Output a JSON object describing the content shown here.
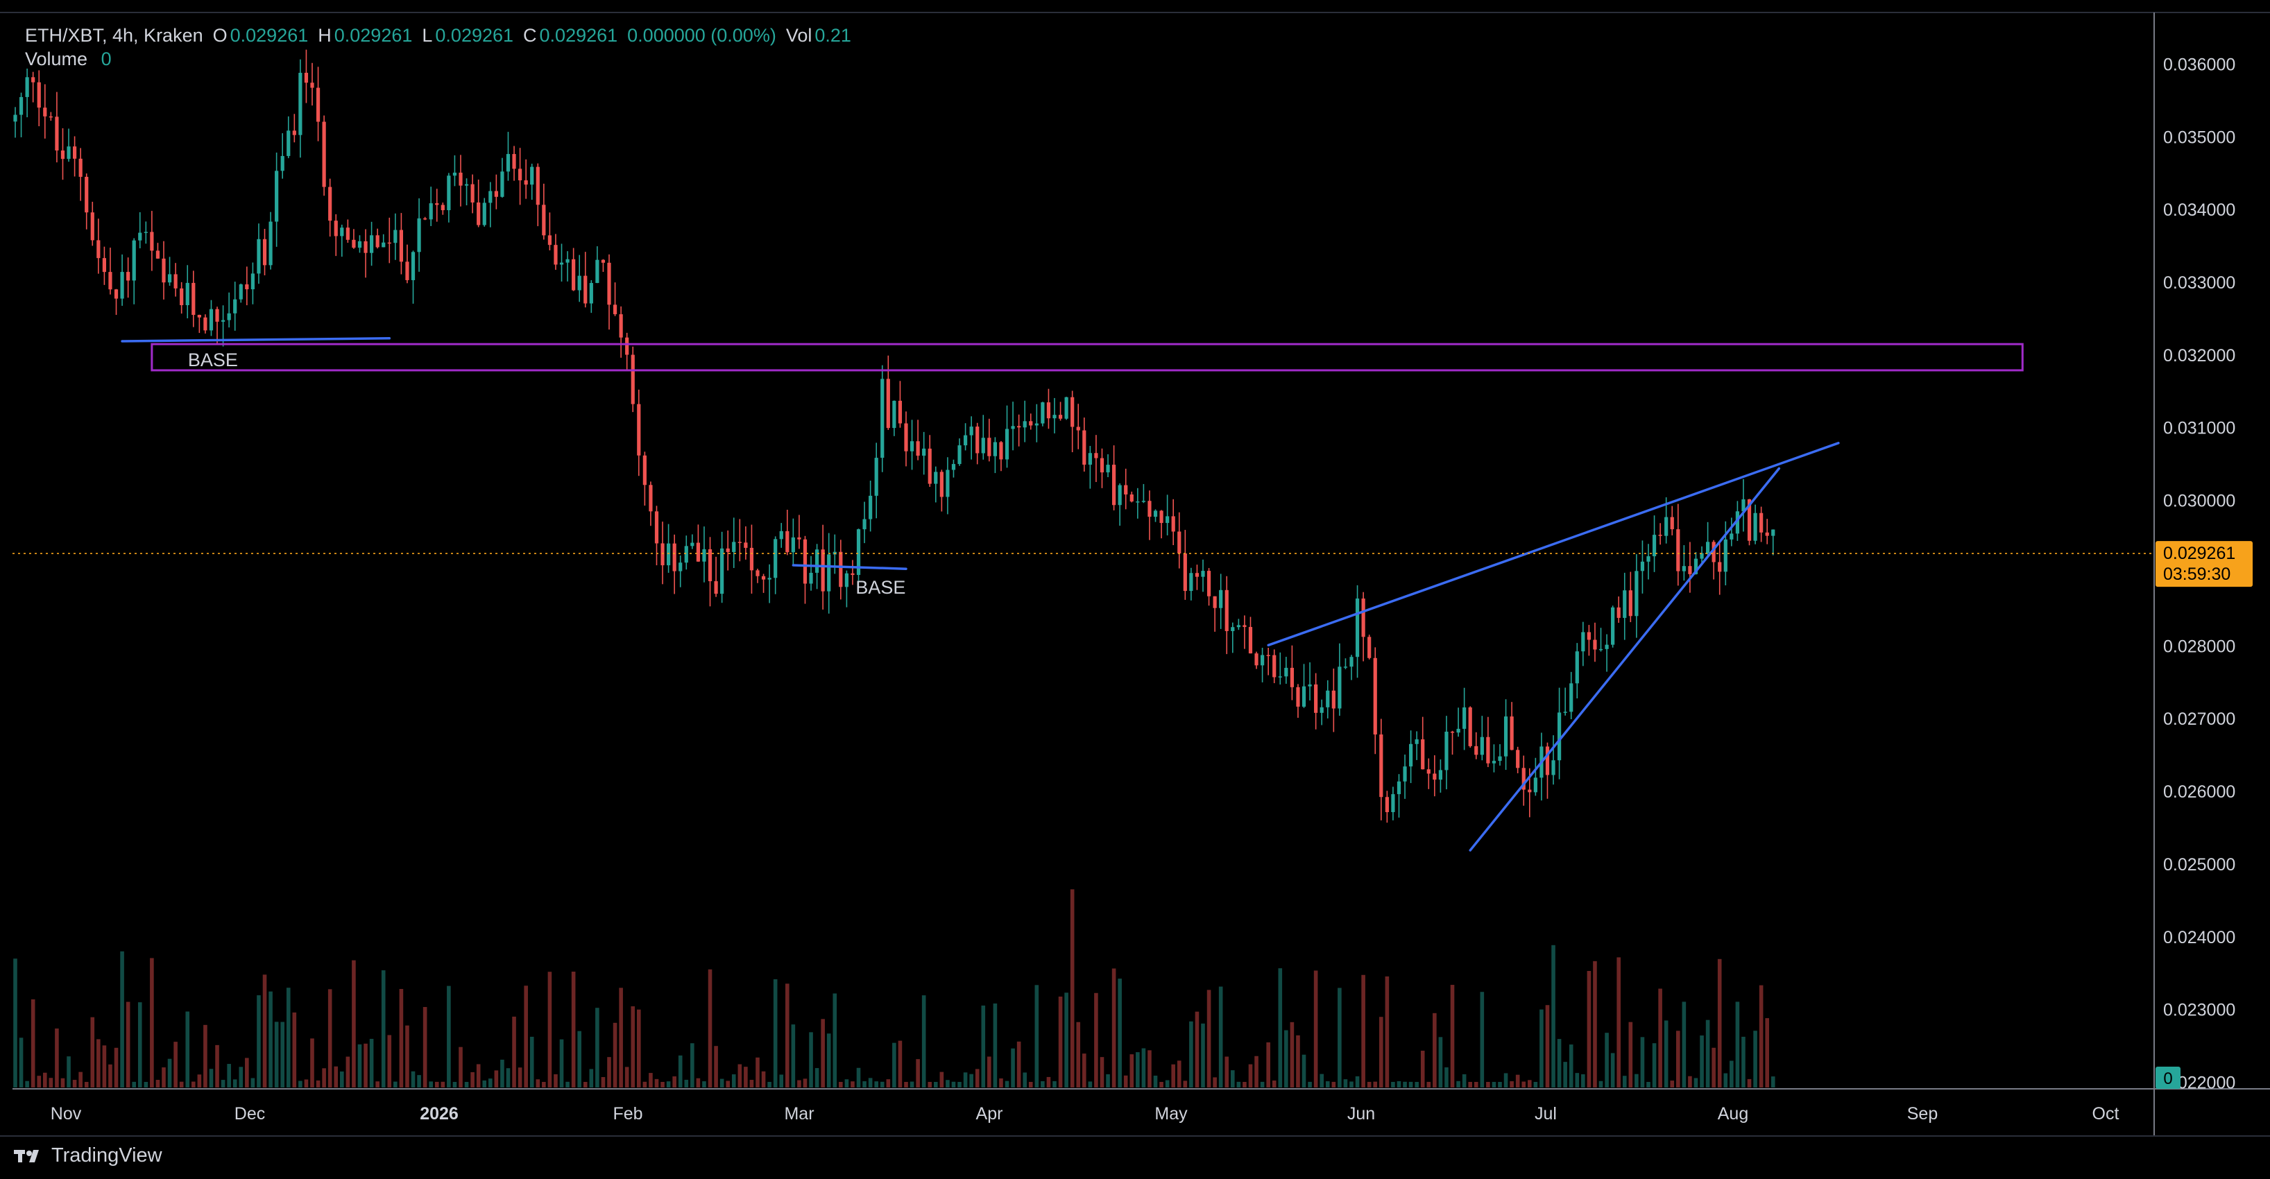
{
  "legend": {
    "symbol": "ETH/XBT, 4h, Kraken",
    "open_label": "O",
    "open": "0.029261",
    "high_label": "H",
    "high": "0.029261",
    "low_label": "L",
    "low": "0.029261",
    "close_label": "C",
    "close": "0.029261",
    "change": "0.000000 (0.00%)",
    "vol_label": "Vol",
    "vol": "0.21",
    "volume_label": "Volume",
    "volume_value": "0"
  },
  "price_tag": {
    "price": "0.029261",
    "countdown": "03:59:30"
  },
  "volume_tag": "0",
  "brand": "TradingView",
  "colors": {
    "up": "#26a69a",
    "down": "#ef5350",
    "line": "#3b6cf2",
    "zone": "#a02bc9",
    "price": "#f7a21b"
  },
  "chart_data": {
    "type": "candlestick",
    "y_ticks": [
      "0.036000",
      "0.035000",
      "0.034000",
      "0.033000",
      "0.032000",
      "0.031000",
      "0.030000",
      "0.029000",
      "0.028000",
      "0.027000",
      "0.026000",
      "0.025000",
      "0.024000",
      "0.023000",
      "0.022000"
    ],
    "x_ticks": [
      "Nov",
      "Dec",
      "2026",
      "Feb",
      "Mar",
      "Apr",
      "May",
      "Jun",
      "Jul",
      "Aug",
      "Sep",
      "Oct"
    ],
    "ylim": [
      0.0219,
      0.0367
    ],
    "price_path": [
      [
        0,
        0.0352
      ],
      [
        3,
        0.0359
      ],
      [
        7,
        0.0348
      ],
      [
        11,
        0.0345
      ],
      [
        14,
        0.0333
      ],
      [
        17,
        0.0327
      ],
      [
        21,
        0.0337
      ],
      [
        25,
        0.0329
      ],
      [
        29,
        0.0327
      ],
      [
        33,
        0.0325
      ],
      [
        38,
        0.0328
      ],
      [
        42,
        0.0335
      ],
      [
        46,
        0.035
      ],
      [
        49,
        0.0359
      ],
      [
        53,
        0.0341
      ],
      [
        57,
        0.0333
      ],
      [
        61,
        0.0336
      ],
      [
        66,
        0.0333
      ],
      [
        71,
        0.034
      ],
      [
        75,
        0.0345
      ],
      [
        79,
        0.0339
      ],
      [
        83,
        0.0346
      ],
      [
        87,
        0.0343
      ],
      [
        91,
        0.0334
      ],
      [
        95,
        0.0329
      ],
      [
        99,
        0.0332
      ],
      [
        101,
        0.0326
      ],
      [
        104,
        0.0316
      ],
      [
        106,
        0.03
      ],
      [
        109,
        0.029
      ],
      [
        113,
        0.0294
      ],
      [
        117,
        0.0289
      ],
      [
        121,
        0.0293
      ],
      [
        125,
        0.0288
      ],
      [
        129,
        0.0294
      ],
      [
        133,
        0.0291
      ],
      [
        137,
        0.029
      ],
      [
        141,
        0.0292
      ],
      [
        144,
        0.03
      ],
      [
        146,
        0.0314
      ],
      [
        149,
        0.031
      ],
      [
        153,
        0.0306
      ],
      [
        157,
        0.0302
      ],
      [
        161,
        0.0308
      ],
      [
        165,
        0.0307
      ],
      [
        169,
        0.0309
      ],
      [
        173,
        0.0314
      ],
      [
        177,
        0.0312
      ],
      [
        181,
        0.0306
      ],
      [
        185,
        0.0302
      ],
      [
        189,
        0.0299
      ],
      [
        193,
        0.0297
      ],
      [
        197,
        0.029
      ],
      [
        201,
        0.0288
      ],
      [
        205,
        0.0283
      ],
      [
        209,
        0.0278
      ],
      [
        213,
        0.0275
      ],
      [
        217,
        0.0273
      ],
      [
        221,
        0.0272
      ],
      [
        224,
        0.0276
      ],
      [
        226,
        0.0284
      ],
      [
        228,
        0.0278
      ],
      [
        230,
        0.0262
      ],
      [
        232,
        0.0258
      ],
      [
        235,
        0.0266
      ],
      [
        239,
        0.0263
      ],
      [
        243,
        0.027
      ],
      [
        247,
        0.0266
      ],
      [
        251,
        0.0268
      ],
      [
        254,
        0.0262
      ],
      [
        258,
        0.0264
      ],
      [
        261,
        0.0272
      ],
      [
        264,
        0.0281
      ],
      [
        268,
        0.0282
      ],
      [
        272,
        0.0287
      ],
      [
        275,
        0.0293
      ],
      [
        278,
        0.0296
      ],
      [
        281,
        0.029
      ],
      [
        284,
        0.0293
      ],
      [
        287,
        0.0291
      ],
      [
        290,
        0.0298
      ],
      [
        293,
        0.0297
      ],
      [
        296,
        0.0293
      ]
    ],
    "annotations": [
      {
        "type": "rectangle",
        "label": "BASE",
        "x1": 23,
        "x2": 338,
        "y1": 0.03214,
        "y2": 0.03178
      },
      {
        "type": "trendline",
        "x1": 18,
        "y1": 0.03218,
        "x2": 63,
        "y2": 0.03222
      },
      {
        "type": "trendline",
        "label": "BASE",
        "x1": 131,
        "y1": 0.0291,
        "x2": 150,
        "y2": 0.02905
      },
      {
        "type": "trendline",
        "x1": 211,
        "y1": 0.028,
        "x2": 307,
        "y2": 0.03078
      },
      {
        "type": "trendline",
        "x1": 245,
        "y1": 0.02518,
        "x2": 297,
        "y2": 0.03043
      }
    ]
  }
}
